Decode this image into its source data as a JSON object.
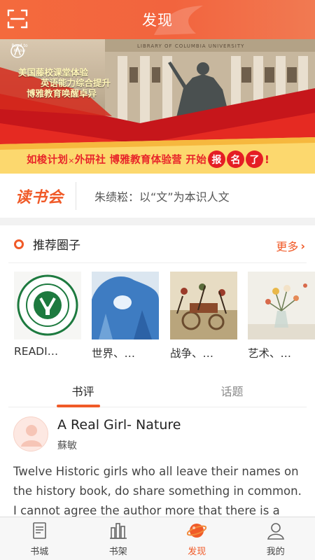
{
  "header": {
    "title": "发现"
  },
  "banner": {
    "logo_text": "Road to Know",
    "lines": [
      "美国藤校课堂体验",
      "英语能力综合提升",
      "博雅教育唤醒卓异"
    ],
    "architecture_text": "LIBRARY OF COLUMBIA UNIVERSITY",
    "bottom_text": "如梭计划",
    "bottom_x": "×",
    "bottom_text2": "外研社 博雅教育体验营 开始",
    "badge_1": "报",
    "badge_2": "名",
    "badge_3": "了",
    "badge_excl": "!"
  },
  "club": {
    "logo": "读书会",
    "text": "朱绩崧：以“文”为本识人文"
  },
  "circles": {
    "title": "推荐圈子",
    "more": "更多",
    "items": [
      {
        "label": "READI…",
        "icon": "university-seal"
      },
      {
        "label": "世界、…",
        "icon": "ice-arch"
      },
      {
        "label": "战争、…",
        "icon": "battle-painting"
      },
      {
        "label": "艺术、…",
        "icon": "flower-vase"
      }
    ]
  },
  "tabs": [
    {
      "label": "书评"
    },
    {
      "label": "话题"
    }
  ],
  "review": {
    "title": "A Real Girl- Nature",
    "author": "蘇敏",
    "body": "Twelve Historic girls who all leave their names on the history book, do share something in common. I cannot agree the author more that there is a real"
  },
  "nav": [
    {
      "label": "书城",
      "icon": "book-icon"
    },
    {
      "label": "书架",
      "icon": "shelf-icon"
    },
    {
      "label": "发现",
      "icon": "planet-icon"
    },
    {
      "label": "我的",
      "icon": "profile-icon"
    }
  ],
  "colors": {
    "accent": "#f05a28",
    "header": "#f46a3d",
    "banner_red": "#e51d24"
  }
}
